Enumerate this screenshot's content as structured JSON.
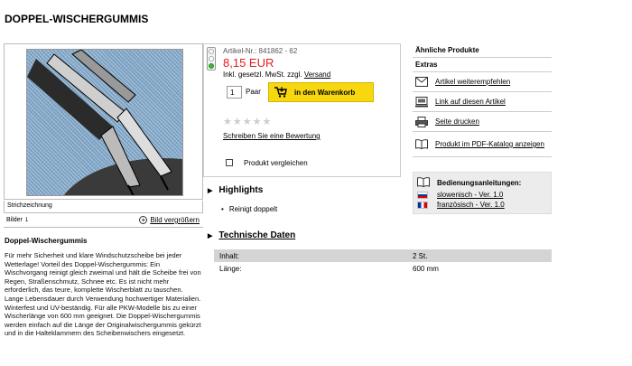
{
  "page": {
    "title": "DOPPEL-WISCHERGUMMIS"
  },
  "image": {
    "caption": "Strichzeichnung",
    "images_label": "Bilder",
    "images_count": "1",
    "enlarge_label": "Bild vergrößern"
  },
  "product": {
    "article_nr": "Artikel-Nr.: 841862 - 62",
    "price": "8,15 EUR",
    "vat_text": "Inkl. gesetzl. MwSt. zzgl.",
    "shipping_link": "Versand",
    "quantity": "1",
    "unit": "Paar",
    "cart_button": "in den Warenkorb",
    "rating_stars": 0,
    "review_link": "Schreiben Sie eine Bewertung",
    "compare_label": "Produkt vergleichen"
  },
  "highlights": {
    "heading": "Highlights",
    "items": [
      "Reinigt doppelt"
    ]
  },
  "tech": {
    "heading": "Technische Daten",
    "rows": [
      {
        "key": "Inhalt:",
        "value": "2 St."
      },
      {
        "key": "Länge:",
        "value": "600 mm"
      }
    ]
  },
  "description": {
    "title": "Doppel-Wischergummis",
    "text": "Für mehr Sicherheit und klare Windschutzscheibe bei jeder Wetterlage! Vorteil des Doppel-Wischergummis: Ein Wischvorgang reinigt gleich zweimal und hält die Scheibe frei von Regen, Straßenschmutz, Schnee etc. Es ist nicht mehr erforderlich, das teure, komplette Wischerblatt zu tauschen. Lange Lebensdauer durch Verwendung hochwertiger Materialien. Winterfest und UV-beständig. Für alle PKW-Modelle bis zu einer Wischerlänge von 600 mm geeignet. Die Doppel-Wischergummis werden einfach auf die Länge der Originalwischergummis gekürzt und in die Halteklammern des Scheibenwischers eingesetzt."
  },
  "sidebar": {
    "similar_label": "Ähnliche Produkte",
    "extras_label": "Extras",
    "items": [
      {
        "label": "Artikel weiterempfehlen",
        "icon": "envelope-icon"
      },
      {
        "label": "Link auf diesen Artikel",
        "icon": "computer-icon"
      },
      {
        "label": "Seite drucken",
        "icon": "printer-icon"
      },
      {
        "label": "Produkt im PDF-Katalog anzeigen",
        "icon": "book-icon"
      }
    ],
    "manuals_heading": "Bedienungsanleitungen:",
    "manuals": [
      {
        "label": "slowenisch - Ver. 1.0",
        "flag": "slovenia-flag"
      },
      {
        "label": "französisch - Ver. 1.0",
        "flag": "france-flag"
      }
    ]
  },
  "colors": {
    "price": "#e41c1c",
    "cart_button": "#f7d810",
    "traffic_light_active": "#3dba2e"
  }
}
